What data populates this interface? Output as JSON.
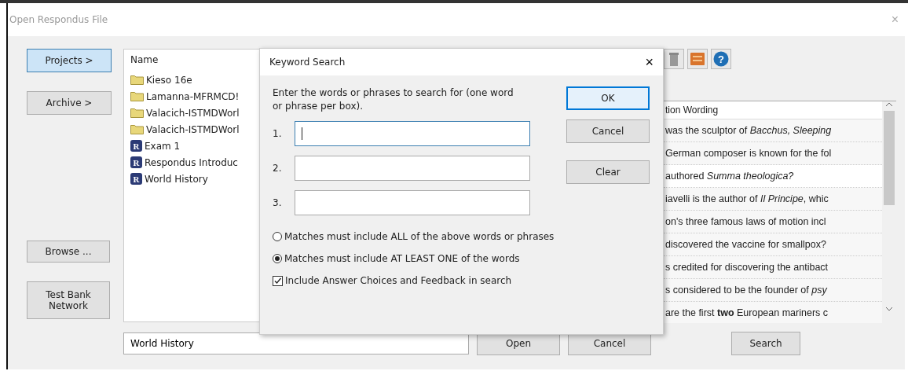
{
  "window": {
    "title": "Open Respondus File",
    "close": "×"
  },
  "side_buttons": [
    {
      "label": "Projects >",
      "selected": true
    },
    {
      "label": "Archive >",
      "selected": false
    }
  ],
  "lower_buttons": [
    {
      "label": "Browse ..."
    },
    {
      "label": "Test Bank Network"
    }
  ],
  "file_list": {
    "header": "Name",
    "items": [
      {
        "name": "Kieso 16e",
        "kind": "folder"
      },
      {
        "name": "Lamanna-MFRMCD!",
        "kind": "folder"
      },
      {
        "name": "Valacich-ISTMDWorl",
        "kind": "folder"
      },
      {
        "name": "Valacich-ISTMDWorl",
        "kind": "folder"
      },
      {
        "name": "Exam 1",
        "kind": "exam",
        "badge": "R"
      },
      {
        "name": "Respondus Introduc",
        "kind": "exam",
        "badge": "R"
      },
      {
        "name": "World History",
        "kind": "exam",
        "badge": "R"
      }
    ]
  },
  "toolbar": [
    {
      "kind": "trash"
    },
    {
      "kind": "list"
    },
    {
      "kind": "help",
      "glyph": "?"
    }
  ],
  "questions": {
    "column": "tion Wording",
    "rows": [
      "was the sculptor of *Bacchus, Sleeping*",
      "German composer is known for the fol",
      "authored *Summa theologica?*",
      "iavelli is the author of *Il Principe*, whic",
      "on's three famous laws of motion incl",
      "discovered the vaccine for smallpox?",
      "s credited for discovering the antibact",
      "s considered to be the founder of *psy*",
      "are the first **two** European mariners c"
    ]
  },
  "file_name": {
    "value": "World History"
  },
  "bottom_buttons": [
    {
      "label": "Open"
    },
    {
      "label": "Cancel"
    },
    {
      "label": "Search"
    }
  ],
  "dialog": {
    "title": "Keyword Search",
    "close": "×",
    "prompt": "Enter the words or phrases to search for (one word or phrase per box).",
    "fields": [
      {
        "label": "1.",
        "focused": true
      },
      {
        "label": "2.",
        "focused": false
      },
      {
        "label": "3.",
        "focused": false
      }
    ],
    "buttons": [
      {
        "label": "OK",
        "default": true
      },
      {
        "label": "Cancel",
        "default": false
      },
      {
        "label": "Clear",
        "default": false
      }
    ],
    "options": [
      {
        "label": "Matches must include ALL of the above words or phrases",
        "selected": false
      },
      {
        "label": "Matches must include AT LEAST ONE of the words",
        "selected": true
      }
    ],
    "checkbox": {
      "label": "Include Answer Choices and Feedback in search",
      "checked": true
    }
  }
}
